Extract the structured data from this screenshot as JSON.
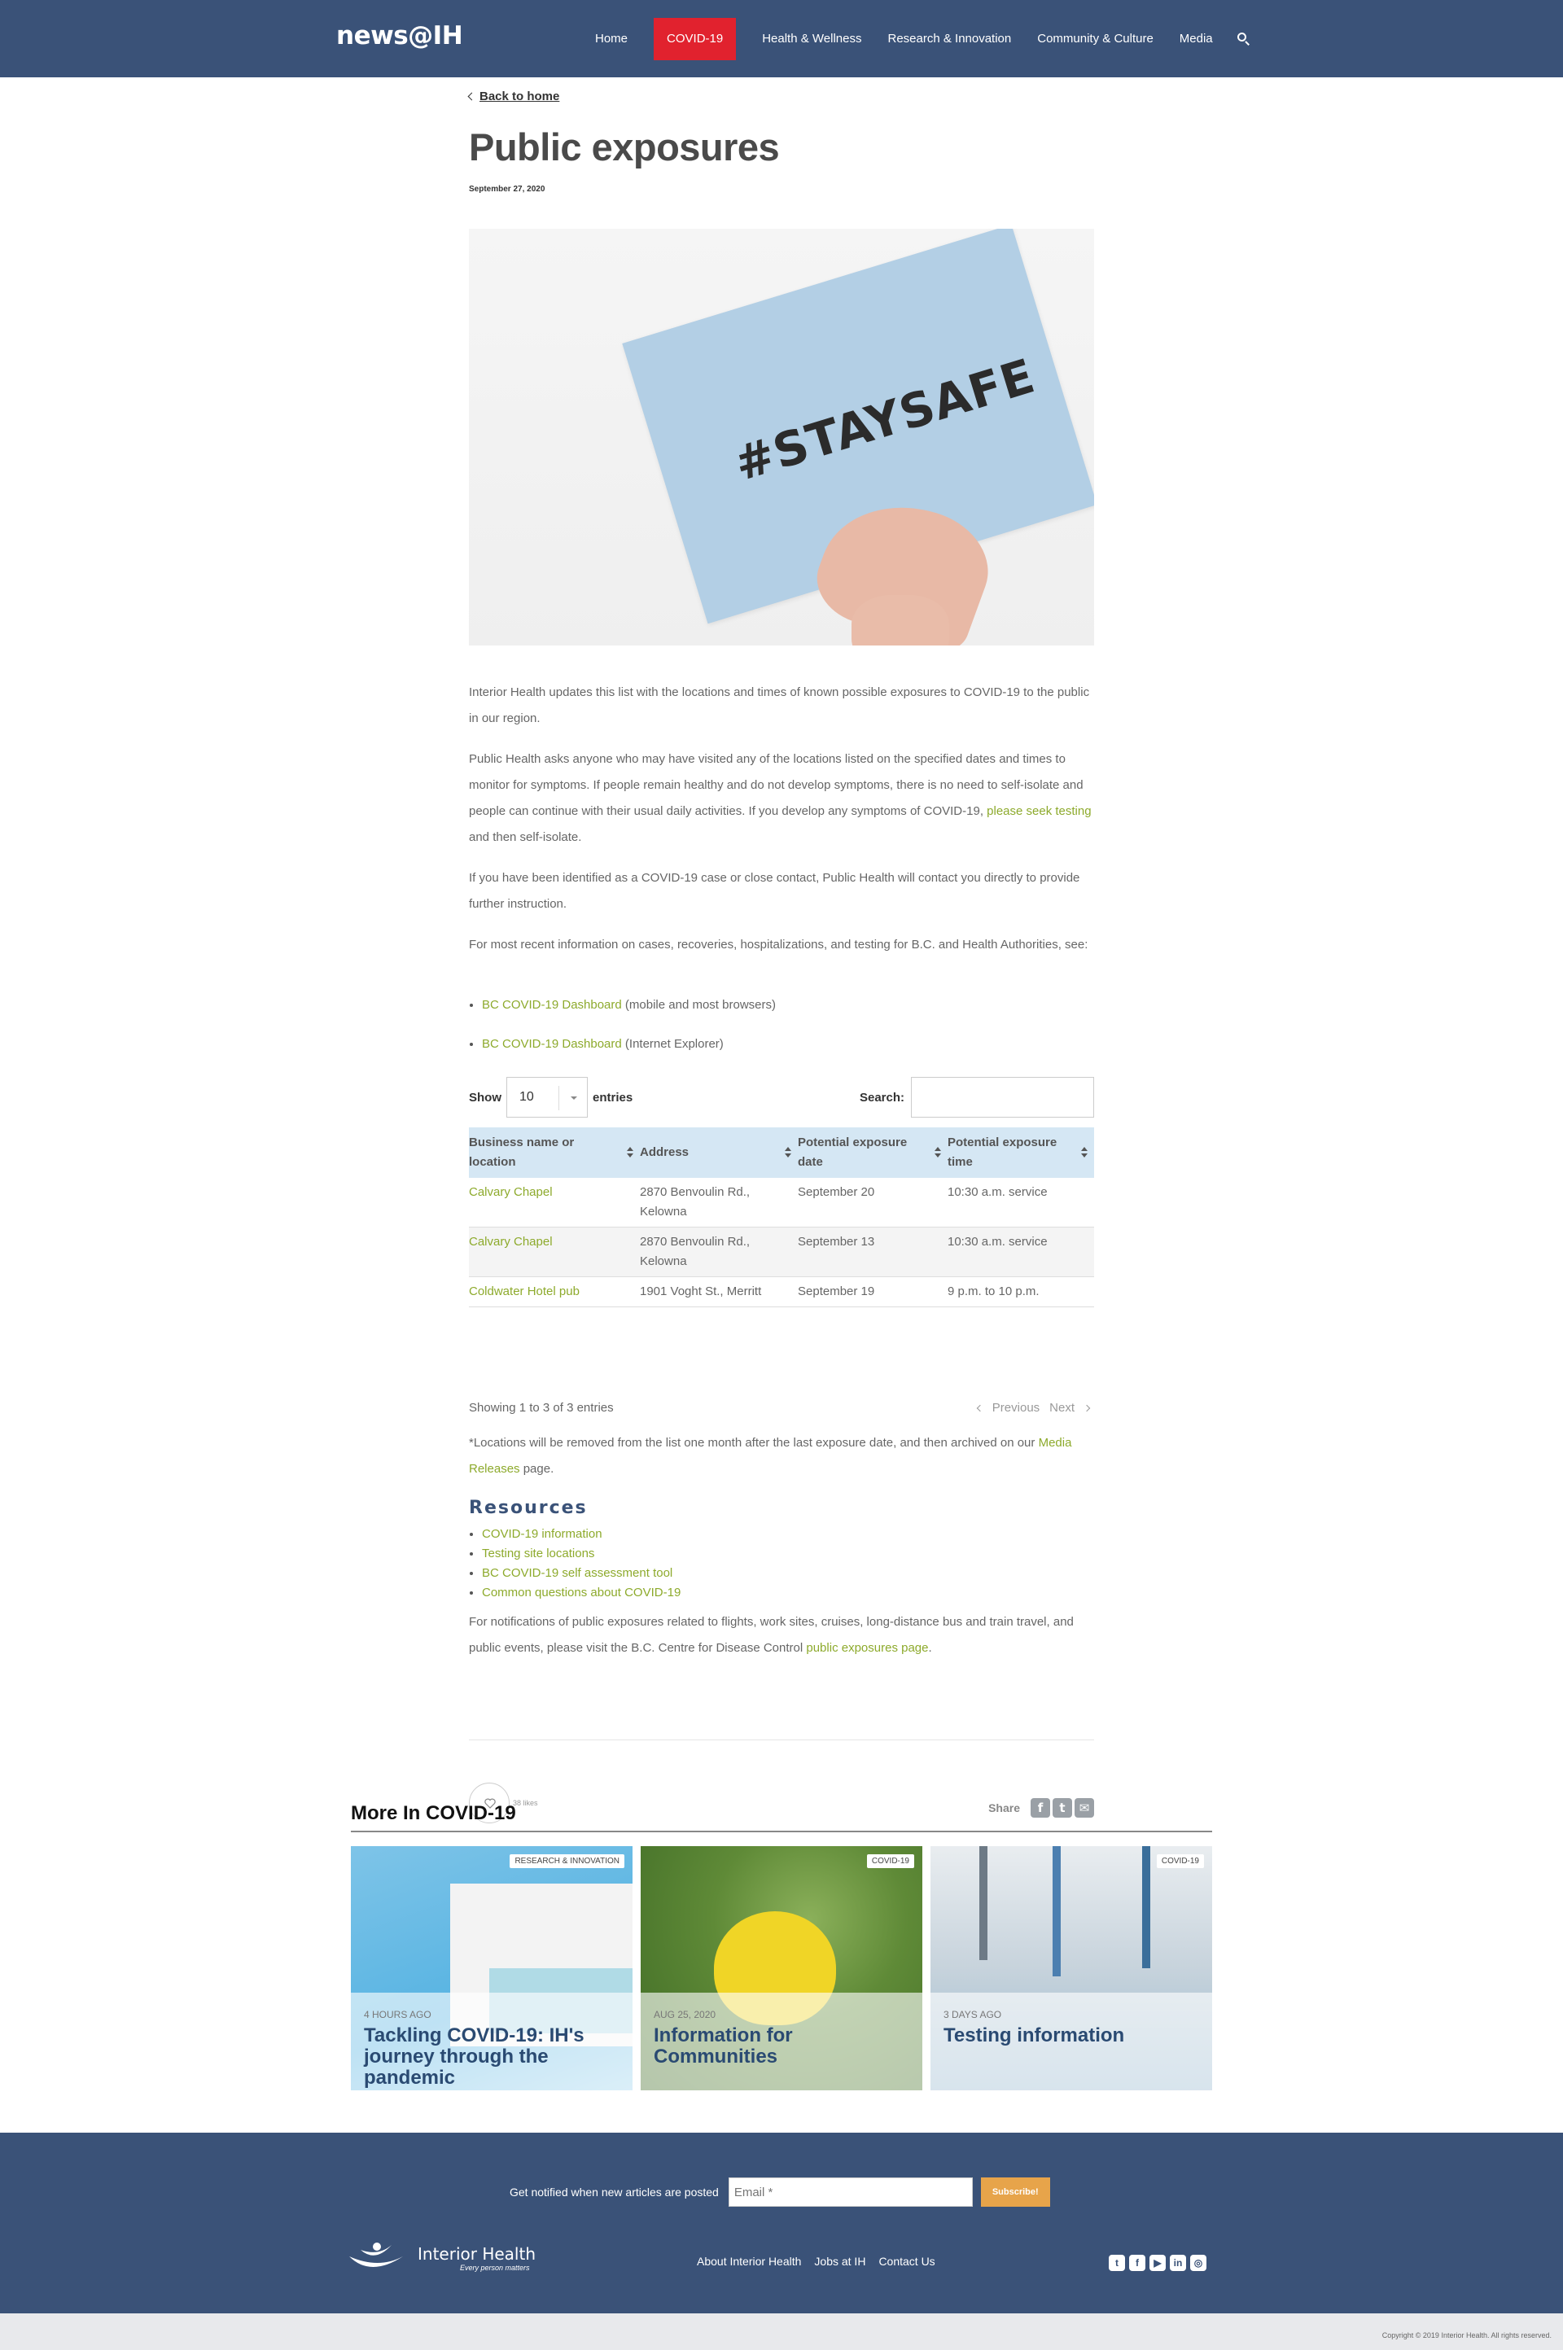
{
  "header": {
    "logo": "news@IH",
    "nav": [
      "Home",
      "COVID-19",
      "Health & Wellness",
      "Research & Innovation",
      "Community & Culture",
      "Media"
    ],
    "active_nav": "COVID-19",
    "search_icon": "search-icon"
  },
  "article": {
    "back_label": "Back to home",
    "title": "Public exposures",
    "date": "September 27, 2020",
    "hero_text": "#STAYSAFE",
    "p1": "Interior Health updates this list with the locations and times of known possible exposures to COVID-19 to the public in our region.",
    "p2_before": "Public Health asks anyone who may have visited any of the locations listed on the specified dates and times to monitor for symptoms. If people remain healthy and do not develop symptoms, there is no need to self-isolate and people can continue with their usual daily activities. If you develop any symptoms of COVID-19, ",
    "p2_link": "please seek testing",
    "p2_after": " and then self-isolate.",
    "p3": "If you have been identified as a COVID-19 case or close contact, Public Health will contact you directly to provide further instruction.",
    "p4": "For most recent information on cases, recoveries, hospitalizations, and testing for B.C. and Health Authorities, see:",
    "dashboard_links": [
      {
        "link": "BC COVID-19 Dashboard",
        "note": " (mobile and most browsers)"
      },
      {
        "link": "BC COVID-19 Dashboard",
        "note": " (Internet Explorer)"
      }
    ]
  },
  "table_controls": {
    "show_label": "Show",
    "entries_value": "10",
    "entries_label": "entries",
    "search_label": "Search:"
  },
  "table": {
    "headers": [
      "Business name or location",
      "Address",
      "Potential exposure date",
      "Potential exposure time"
    ],
    "rows": [
      [
        "Calvary Chapel",
        "2870 Benvoulin Rd., Kelowna",
        "September 20",
        "10:30 a.m. service"
      ],
      [
        "Calvary Chapel",
        "2870 Benvoulin Rd., Kelowna",
        "September 13",
        "10:30 a.m. service"
      ],
      [
        "Coldwater Hotel pub",
        "1901 Voght St., Merritt",
        "September 19",
        "9 p.m. to 10 p.m."
      ]
    ],
    "info": "Showing 1 to 3 of 3 entries",
    "previous": "Previous",
    "next": "Next"
  },
  "notes": {
    "removal_before": "*Locations will be removed from the list one month after the last exposure date, and then archived on our ",
    "removal_link": "Media Releases",
    "removal_after": " page.",
    "resources_heading": "Resources",
    "resources": [
      "COVID-19 information",
      "Testing site locations",
      "BC COVID-19 self assessment tool",
      "Common questions about COVID-19"
    ],
    "bccdc_before": "For notifications of public exposures related to flights, work sites, cruises, long-distance bus and train travel, and public events, please visit the B.C. Centre for Disease Control ",
    "bccdc_link": "public exposures page",
    "bccdc_after": "."
  },
  "engagement": {
    "likes": "38 likes",
    "share_label": "Share",
    "share_icons": [
      "facebook-icon",
      "twitter-icon",
      "email-icon"
    ]
  },
  "more": {
    "heading": "More In COVID-19",
    "cards": [
      {
        "tag": "RESEARCH & INNOVATION",
        "ago": "4 HOURS AGO",
        "title": "Tackling COVID-19: IH's journey through the pandemic"
      },
      {
        "tag": "COVID-19",
        "ago": "AUG 25, 2020",
        "title": "Information for Communities"
      },
      {
        "tag": "COVID-19",
        "ago": "3 DAYS AGO",
        "title": "Testing information"
      }
    ]
  },
  "footer": {
    "notify_label": "Get notified when new articles are posted",
    "email_placeholder": "Email *",
    "subscribe": "Subscribe!",
    "org_name": "Interior Health",
    "tagline": "Every person matters",
    "links": [
      "About Interior Health",
      "Jobs at IH",
      "Contact Us"
    ],
    "social_icons": [
      "twitter-icon",
      "facebook-icon",
      "youtube-icon",
      "linkedin-icon",
      "instagram-icon"
    ],
    "copyright": "Copyright © 2019 Interior Health. All rights reserved."
  },
  "colors": {
    "header_bg": "#3a5278",
    "accent_red": "#e1222e",
    "link_green": "#8daa2c",
    "table_header_bg": "#d5e7f4",
    "subscribe_orange": "#e7a44a"
  }
}
